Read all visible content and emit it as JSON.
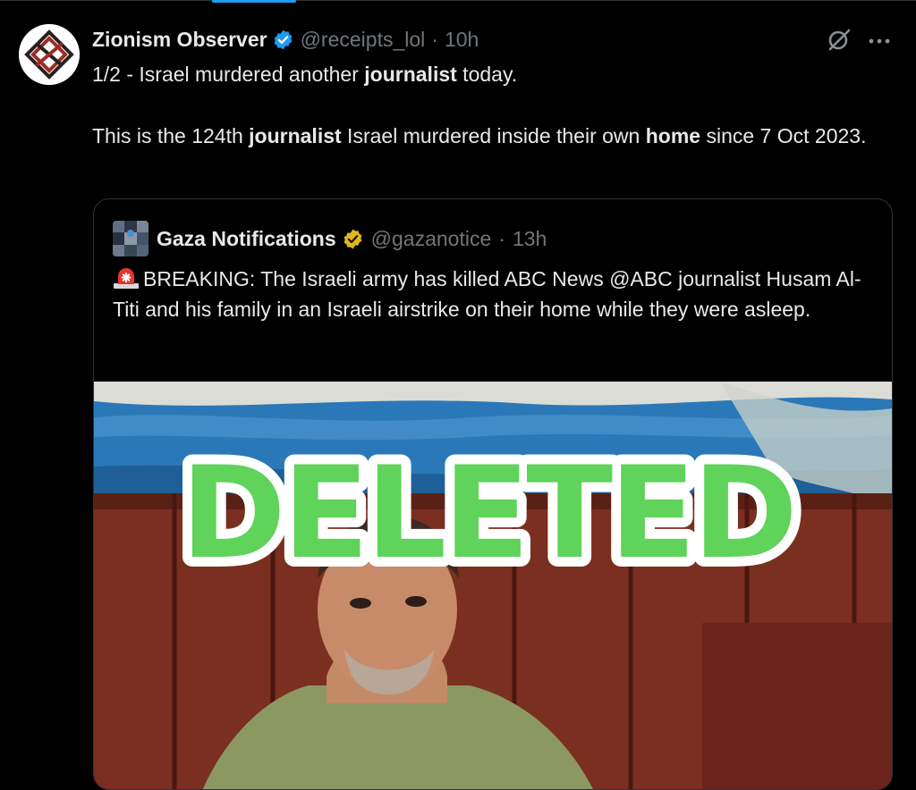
{
  "tweet": {
    "author_name": "Zionism Observer",
    "author_handle": "@receipts_lol",
    "separator": "·",
    "time": "10h",
    "text": {
      "line1_a": "1/2 - Israel murdered another ",
      "line1_b": "journalist",
      "line1_c": " today.",
      "para2_a": "This is the 124th ",
      "para2_b": "journalist",
      "para2_c": " Israel murdered inside their own ",
      "para2_d": "home",
      "para2_e": " since 7 Oct 2023."
    },
    "icons": {
      "verified": "verified-badge-blue",
      "grok": "grok-icon",
      "more": "more-icon"
    }
  },
  "quote": {
    "author_name": "Gaza Notifications",
    "author_handle": "@gazanotice",
    "separator": "·",
    "time": "13h",
    "text": "BREAKING: The Israeli army has killed ABC News @ABC journalist Husam Al-Titi and his family in an Israeli airstrike on their home while they were asleep.",
    "icons": {
      "verified": "verified-badge-gold",
      "siren": "siren-emoji"
    },
    "image": {
      "overlay_text": "DELETED"
    }
  },
  "colors": {
    "background": "#000000",
    "text": "#e7e9ea",
    "muted": "#71767b",
    "border": "#2f3336",
    "verified_blue": "#1d9bf0",
    "verified_gold": "#e2b719",
    "deleted_green": "#5fd35a"
  }
}
